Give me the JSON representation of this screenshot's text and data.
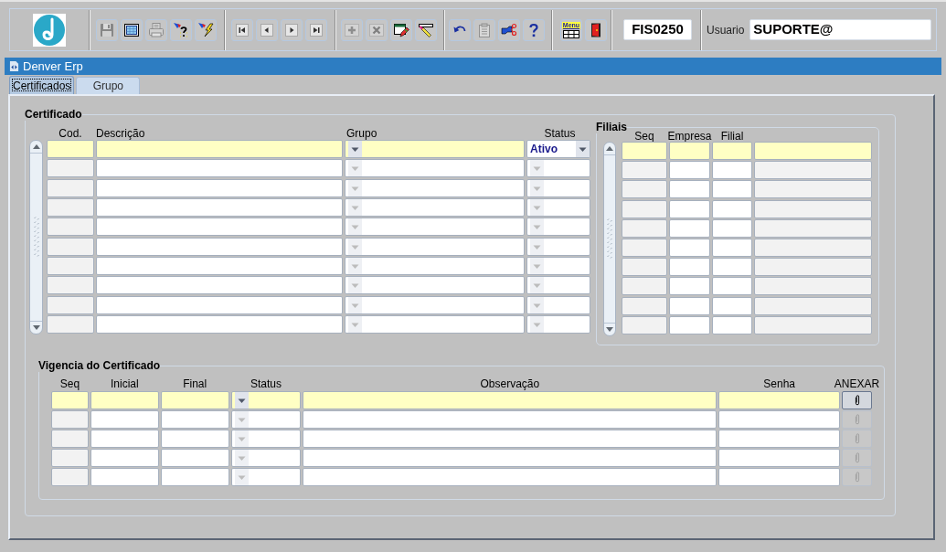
{
  "toolbar": {
    "groups": [
      [
        {
          "disabled": true
        },
        {
          "disabled": false
        },
        {
          "disabled": true
        },
        {
          "disabled": false
        },
        {
          "disabled": false
        }
      ],
      [
        {
          "disabled": false
        },
        {
          "disabled": false
        },
        {
          "disabled": false
        },
        {
          "disabled": false
        }
      ],
      [
        {
          "disabled": true
        },
        {
          "disabled": true
        },
        {
          "disabled": false
        },
        {
          "disabled": false
        }
      ],
      [
        {
          "disabled": false
        },
        {
          "disabled": true
        },
        {
          "disabled": false
        },
        {
          "disabled": false
        }
      ],
      [
        {
          "label": "Menu",
          "disabled": false
        },
        {
          "disabled": false
        }
      ]
    ],
    "form_code": "FIS0250",
    "user": {
      "label": "Usuario",
      "value": "SUPORTE@"
    }
  },
  "window": {
    "title": "Denver Erp"
  },
  "tabs": [
    {
      "label": "Certificados",
      "selected": true
    },
    {
      "label": "Grupo",
      "selected": false
    }
  ],
  "certificado": {
    "title": "Certificado",
    "columns": [
      "Cod.",
      "Descrição",
      "Grupo",
      "Status"
    ],
    "rows": [
      {
        "selected": true,
        "status": "Ativo"
      },
      {
        "selected": false
      },
      {
        "selected": false
      },
      {
        "selected": false
      },
      {
        "selected": false
      },
      {
        "selected": false
      },
      {
        "selected": false
      },
      {
        "selected": false
      },
      {
        "selected": false
      },
      {
        "selected": false
      }
    ]
  },
  "filiais": {
    "title": "Filiais",
    "columns": [
      "Seq",
      "Empresa",
      "Filial"
    ],
    "rows": [
      {
        "selected": true
      },
      {
        "selected": false
      },
      {
        "selected": false
      },
      {
        "selected": false
      },
      {
        "selected": false
      },
      {
        "selected": false
      },
      {
        "selected": false
      },
      {
        "selected": false
      },
      {
        "selected": false
      },
      {
        "selected": false
      }
    ]
  },
  "vigencia": {
    "title": "Vigencia do Certificado",
    "columns": [
      "Seq",
      "Inicial",
      "Final",
      "Status",
      "Observação",
      "Senha",
      "ANEXAR"
    ],
    "rows": [
      {
        "selected": true,
        "attach_disabled": false
      },
      {
        "selected": false,
        "attach_disabled": true
      },
      {
        "selected": false,
        "attach_disabled": true
      },
      {
        "selected": false,
        "attach_disabled": true
      },
      {
        "selected": false,
        "attach_disabled": true
      }
    ]
  }
}
